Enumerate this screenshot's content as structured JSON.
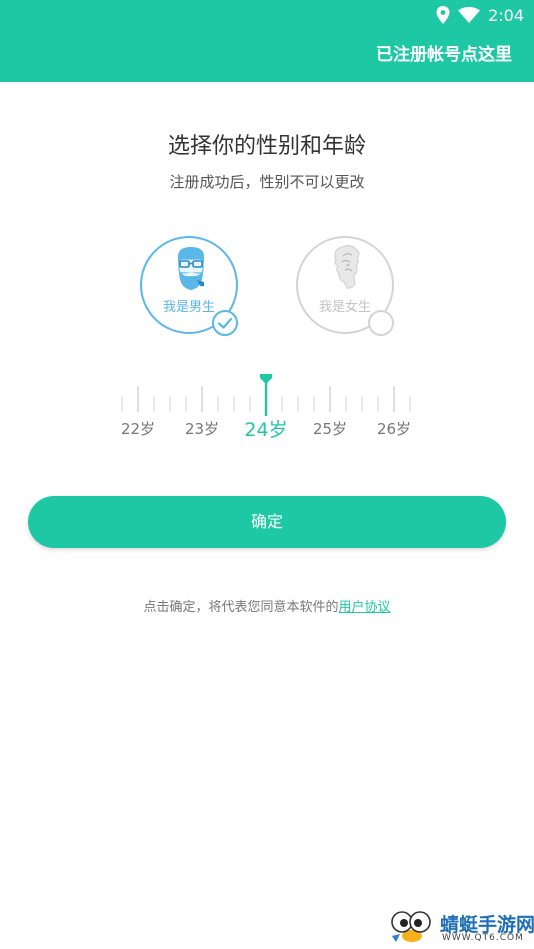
{
  "status_bar": {
    "time": "2:04",
    "icons": [
      "location-icon",
      "wifi-icon"
    ]
  },
  "header": {
    "register_link": "已注册帐号点这里"
  },
  "main": {
    "title": "选择你的性别和年龄",
    "subtitle": "注册成功后，性别不可以更改",
    "genders": [
      {
        "label": "我是男生",
        "selected": true
      },
      {
        "label": "我是女生",
        "selected": false
      }
    ],
    "age_picker": {
      "labels": [
        "22岁",
        "23岁",
        "24岁",
        "25岁",
        "26岁"
      ],
      "selected": "24岁"
    },
    "confirm_label": "确定",
    "agreement": {
      "text": "点击确定，将代表您同意本软件的",
      "link": "用户协议"
    }
  },
  "watermark": {
    "title": "蜻蜓手游网",
    "url": "WWW.QT6.COM"
  },
  "colors": {
    "accent": "#1ec8a4",
    "male": "#5ab8e8",
    "inactive": "#c4c4c4"
  }
}
